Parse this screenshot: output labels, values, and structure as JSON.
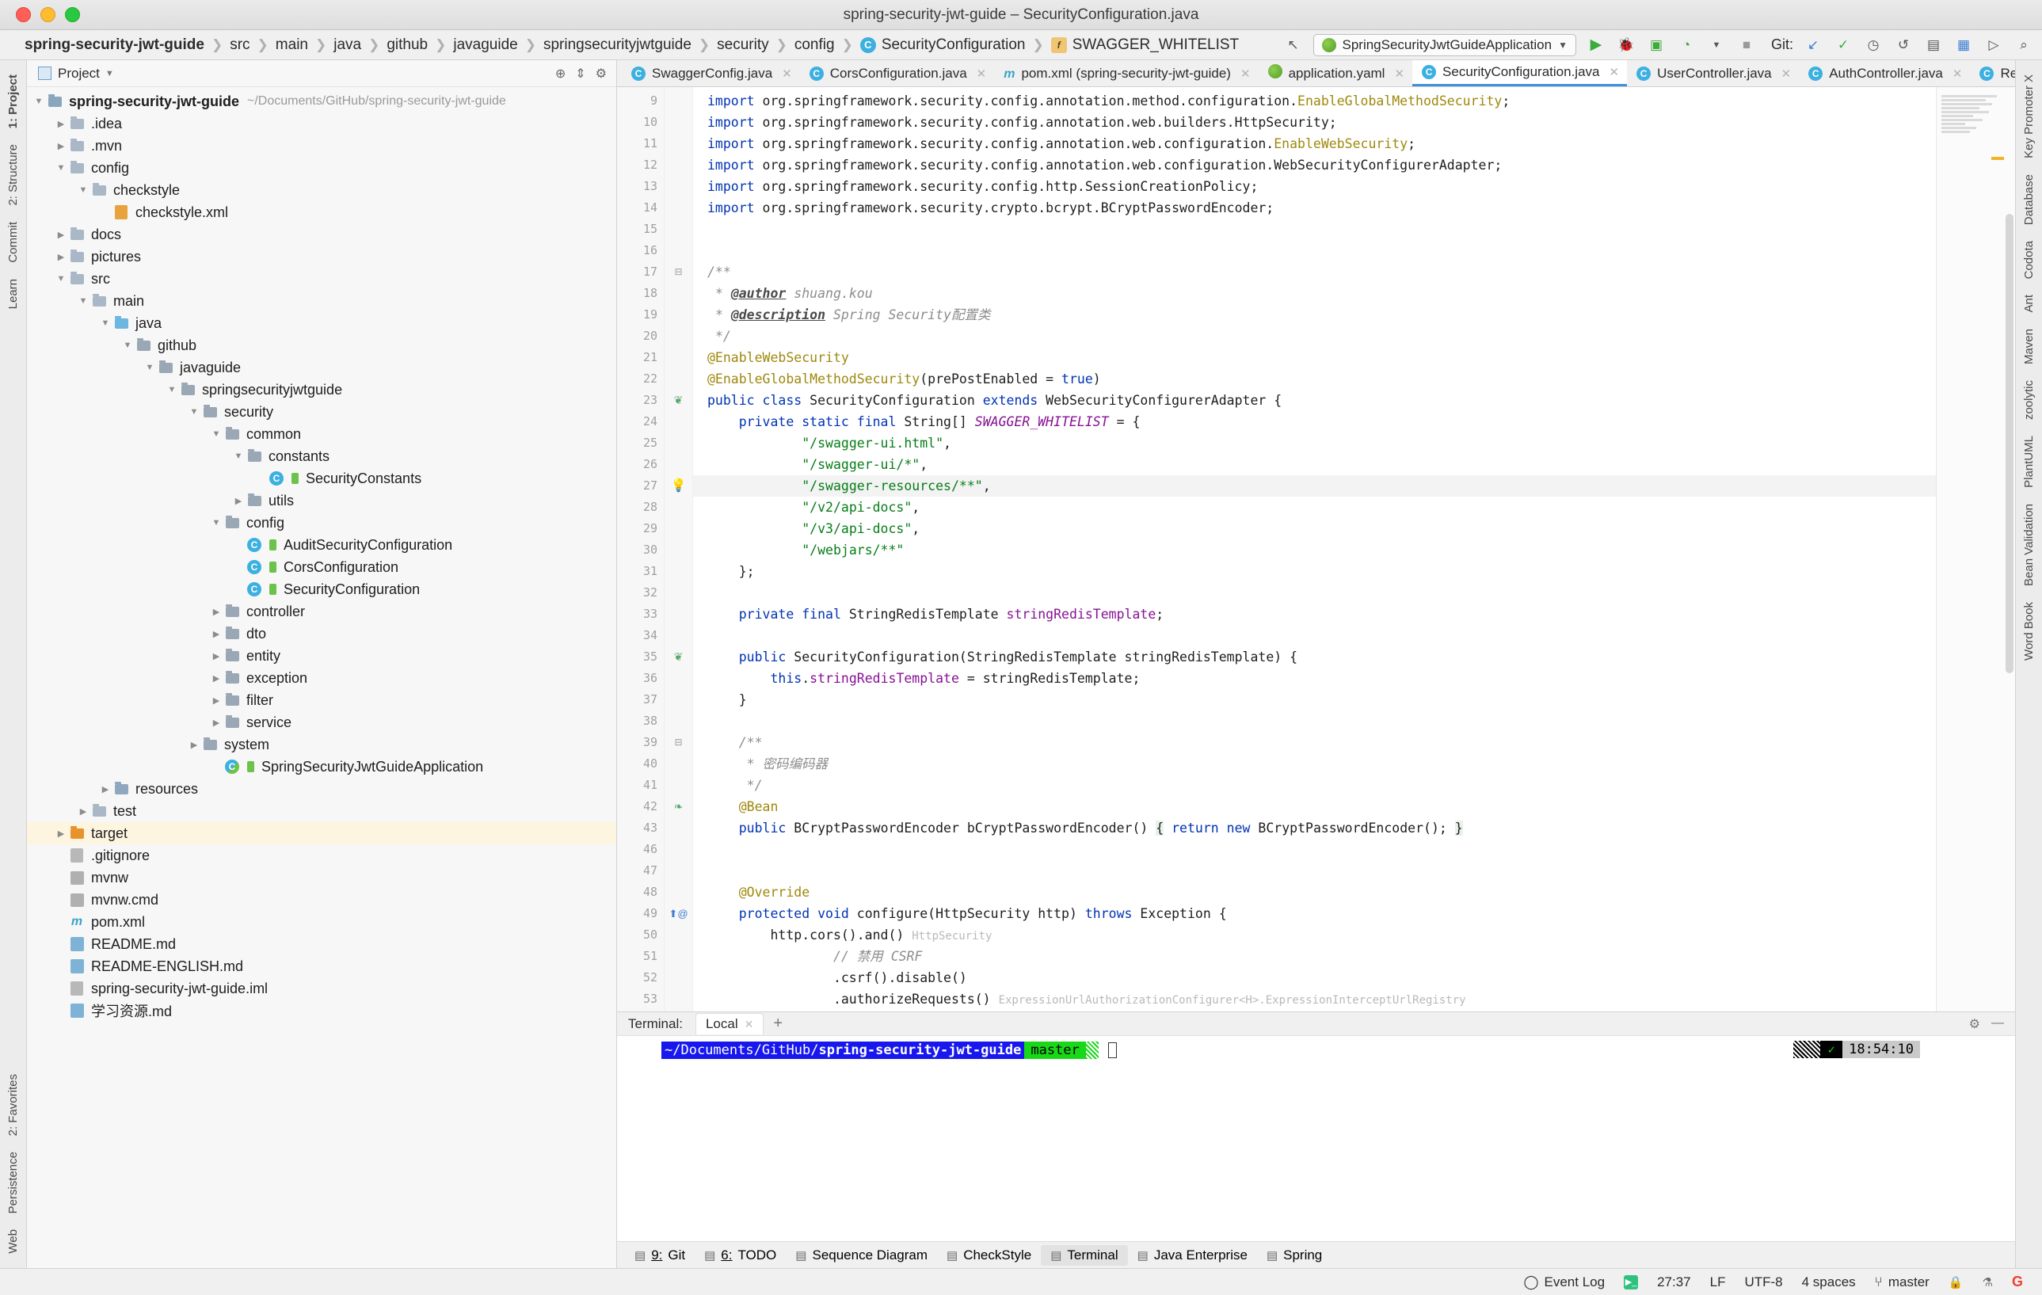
{
  "window": {
    "title": "spring-security-jwt-guide – SecurityConfiguration.java",
    "traffic_lights": [
      "close-red",
      "minimize-yellow",
      "maximize-green"
    ]
  },
  "navbar": {
    "crumbs": [
      {
        "label": "spring-security-jwt-guide",
        "icon": null,
        "root": true
      },
      {
        "label": "src",
        "icon": null
      },
      {
        "label": "main",
        "icon": null
      },
      {
        "label": "java",
        "icon": null
      },
      {
        "label": "github",
        "icon": null
      },
      {
        "label": "javaguide",
        "icon": null
      },
      {
        "label": "springsecurityjwtguide",
        "icon": null
      },
      {
        "label": "security",
        "icon": null
      },
      {
        "label": "config",
        "icon": null
      },
      {
        "label": "SecurityConfiguration",
        "icon": "class-icon"
      },
      {
        "label": "SWAGGER_WHITELIST",
        "icon": "field-icon"
      }
    ],
    "run_config": "SpringSecurityJwtGuideApplication",
    "git_label": "Git:",
    "buttons": [
      "back-arrow-icon",
      "run-icon",
      "debug-icon",
      "run-with-coverage-icon",
      "profile-icon",
      "stop-icon",
      "update-project-icon",
      "commit-icon",
      "history-icon",
      "rollback-icon",
      "search-everywhere-icon"
    ]
  },
  "project_panel": {
    "header": "Project",
    "header_icons": [
      "locate-icon",
      "collapse-all-icon",
      "settings-gear-icon"
    ],
    "tree": [
      {
        "label": "spring-security-jwt-guide",
        "path": "~/Documents/GitHub/spring-security-jwt-guide",
        "indent": 0,
        "arrow": "down",
        "icon": "module-icon",
        "bold": true
      },
      {
        "label": ".idea",
        "indent": 1,
        "arrow": "right",
        "icon": "folder-icon"
      },
      {
        "label": ".mvn",
        "indent": 1,
        "arrow": "right",
        "icon": "folder-icon"
      },
      {
        "label": "config",
        "indent": 1,
        "arrow": "down",
        "icon": "folder-icon"
      },
      {
        "label": "checkstyle",
        "indent": 2,
        "arrow": "down",
        "icon": "folder-icon"
      },
      {
        "label": "checkstyle.xml",
        "indent": 3,
        "arrow": "none",
        "icon": "xml-file-icon"
      },
      {
        "label": "docs",
        "indent": 1,
        "arrow": "right",
        "icon": "folder-icon"
      },
      {
        "label": "pictures",
        "indent": 1,
        "arrow": "right",
        "icon": "folder-icon"
      },
      {
        "label": "src",
        "indent": 1,
        "arrow": "down",
        "icon": "folder-icon"
      },
      {
        "label": "main",
        "indent": 2,
        "arrow": "down",
        "icon": "folder-icon"
      },
      {
        "label": "java",
        "indent": 3,
        "arrow": "down",
        "icon": "source-folder-icon"
      },
      {
        "label": "github",
        "indent": 4,
        "arrow": "down",
        "icon": "package-icon"
      },
      {
        "label": "javaguide",
        "indent": 5,
        "arrow": "down",
        "icon": "package-icon"
      },
      {
        "label": "springsecurityjwtguide",
        "indent": 6,
        "arrow": "down",
        "icon": "package-icon"
      },
      {
        "label": "security",
        "indent": 7,
        "arrow": "down",
        "icon": "package-icon"
      },
      {
        "label": "common",
        "indent": 8,
        "arrow": "down",
        "icon": "package-icon"
      },
      {
        "label": "constants",
        "indent": 9,
        "arrow": "down",
        "icon": "package-icon"
      },
      {
        "label": "SecurityConstants",
        "indent": 10,
        "arrow": "none",
        "icon": "class-icon"
      },
      {
        "label": "utils",
        "indent": 9,
        "arrow": "right",
        "icon": "package-icon"
      },
      {
        "label": "config",
        "indent": 8,
        "arrow": "down",
        "icon": "package-icon"
      },
      {
        "label": "AuditSecurityConfiguration",
        "indent": 9,
        "arrow": "none",
        "icon": "class-icon"
      },
      {
        "label": "CorsConfiguration",
        "indent": 9,
        "arrow": "none",
        "icon": "class-icon"
      },
      {
        "label": "SecurityConfiguration",
        "indent": 9,
        "arrow": "none",
        "icon": "class-icon"
      },
      {
        "label": "controller",
        "indent": 8,
        "arrow": "right",
        "icon": "package-icon"
      },
      {
        "label": "dto",
        "indent": 8,
        "arrow": "right",
        "icon": "package-icon"
      },
      {
        "label": "entity",
        "indent": 8,
        "arrow": "right",
        "icon": "package-icon"
      },
      {
        "label": "exception",
        "indent": 8,
        "arrow": "right",
        "icon": "package-icon"
      },
      {
        "label": "filter",
        "indent": 8,
        "arrow": "right",
        "icon": "package-icon"
      },
      {
        "label": "service",
        "indent": 8,
        "arrow": "right",
        "icon": "package-icon"
      },
      {
        "label": "system",
        "indent": 7,
        "arrow": "right",
        "icon": "package-icon"
      },
      {
        "label": "SpringSecurityJwtGuideApplication",
        "indent": 8,
        "arrow": "none",
        "icon": "spring-class-icon"
      },
      {
        "label": "resources",
        "indent": 3,
        "arrow": "right",
        "icon": "resource-folder-icon"
      },
      {
        "label": "test",
        "indent": 2,
        "arrow": "right",
        "icon": "folder-icon"
      },
      {
        "label": "target",
        "indent": 1,
        "arrow": "right",
        "icon": "excluded-folder-icon",
        "highlight": true
      },
      {
        "label": ".gitignore",
        "indent": 1,
        "arrow": "none",
        "icon": "gitignore-file-icon"
      },
      {
        "label": "mvnw",
        "indent": 1,
        "arrow": "none",
        "icon": "script-file-icon"
      },
      {
        "label": "mvnw.cmd",
        "indent": 1,
        "arrow": "none",
        "icon": "cmd-file-icon"
      },
      {
        "label": "pom.xml",
        "indent": 1,
        "arrow": "none",
        "icon": "maven-file-icon"
      },
      {
        "label": "README.md",
        "indent": 1,
        "arrow": "none",
        "icon": "markdown-file-icon"
      },
      {
        "label": "README-ENGLISH.md",
        "indent": 1,
        "arrow": "none",
        "icon": "markdown-file-icon"
      },
      {
        "label": "spring-security-jwt-guide.iml",
        "indent": 1,
        "arrow": "none",
        "icon": "iml-file-icon"
      },
      {
        "label": "学习资源.md",
        "indent": 1,
        "arrow": "none",
        "icon": "markdown-file-icon"
      }
    ]
  },
  "left_strip": {
    "top": [
      "1: Project",
      "2: Structure",
      "Commit",
      "Learn"
    ],
    "bottom": [
      "2: Favorites",
      "Persistence",
      "Web"
    ]
  },
  "right_strip": {
    "items": [
      "Key Promoter X",
      "Database",
      "Codota",
      "Ant",
      "Maven",
      "zoolytic",
      "PlantUML",
      "Bean Validation",
      "Word Book"
    ]
  },
  "editor_tabs": [
    {
      "label": "SwaggerConfig.java",
      "icon": "class-icon",
      "active": false
    },
    {
      "label": "CorsConfiguration.java",
      "icon": "class-icon",
      "active": false
    },
    {
      "label": "pom.xml (spring-security-jwt-guide)",
      "icon": "maven-file-icon",
      "active": false
    },
    {
      "label": "application.yaml",
      "icon": "spring-yaml-icon",
      "active": false
    },
    {
      "label": "SecurityConfiguration.java",
      "icon": "class-icon",
      "active": true
    },
    {
      "label": "UserController.java",
      "icon": "class-icon",
      "active": false
    },
    {
      "label": "AuthController.java",
      "icon": "class-icon",
      "active": false
    },
    {
      "label": "RedisConfig.java",
      "icon": "class-icon",
      "active": false
    }
  ],
  "code": {
    "first_line": 9,
    "current_line": 27,
    "lines": [
      {
        "n": 9,
        "html": "<span class=\"kw\">import</span> org.springframework.security.config.annotation.method.configuration.<span class=\"ann\">EnableGlobalMethodSecurity</span>;"
      },
      {
        "n": 10,
        "html": "<span class=\"kw\">import</span> org.springframework.security.config.annotation.web.builders.HttpSecurity;"
      },
      {
        "n": 11,
        "html": "<span class=\"kw\">import</span> org.springframework.security.config.annotation.web.configuration.<span class=\"ann\">EnableWebSecurity</span>;"
      },
      {
        "n": 12,
        "html": "<span class=\"kw\">import</span> org.springframework.security.config.annotation.web.configuration.WebSecurityConfigurerAdapter;"
      },
      {
        "n": 13,
        "html": "<span class=\"kw\">import</span> org.springframework.security.config.http.SessionCreationPolicy;"
      },
      {
        "n": 14,
        "html": "<span class=\"kw\">import</span> org.springframework.security.crypto.bcrypt.BCryptPasswordEncoder;"
      },
      {
        "n": 15,
        "html": ""
      },
      {
        "n": 16,
        "html": ""
      },
      {
        "n": 17,
        "html": "<span class=\"doc\">/**</span>",
        "fold": true
      },
      {
        "n": 18,
        "html": " <span class=\"doc\">* </span><span class=\"doctag\">@author</span><span class=\"doc\"> shuang.kou</span>"
      },
      {
        "n": 19,
        "html": " <span class=\"doc\">* </span><span class=\"doctag\">@description</span><span class=\"doc\"> Spring Security配置类</span>"
      },
      {
        "n": 20,
        "html": " <span class=\"doc\">*/</span>"
      },
      {
        "n": 21,
        "html": "<span class=\"ann\">@EnableWebSecurity</span>"
      },
      {
        "n": 22,
        "html": "<span class=\"ann\">@EnableGlobalMethodSecurity</span>(prePostEnabled = <span class=\"kw\">true</span>)"
      },
      {
        "n": 23,
        "html": "<span class=\"kw\">public class</span> SecurityConfiguration <span class=\"kw\">extends</span> WebSecurityConfigurerAdapter {",
        "gmark": "spring"
      },
      {
        "n": 24,
        "html": "    <span class=\"kw\">private static final</span> String[] <span class=\"sfld\">SWAGGER_WHITELIST</span> = {"
      },
      {
        "n": 25,
        "html": "            <span class=\"str\">\"/swagger-ui.html\"</span>,"
      },
      {
        "n": 26,
        "html": "            <span class=\"str\">\"/swagger-ui/*\"</span>,"
      },
      {
        "n": 27,
        "html": "            <span class=\"str\">\"/swagger-resources/**\"</span>,",
        "gmark": "bulb",
        "current": true
      },
      {
        "n": 28,
        "html": "            <span class=\"str\">\"/v2/api-docs\"</span>,"
      },
      {
        "n": 29,
        "html": "            <span class=\"str\">\"/v3/api-docs\"</span>,"
      },
      {
        "n": 30,
        "html": "            <span class=\"str\">\"/webjars/**\"</span>"
      },
      {
        "n": 31,
        "html": "    };"
      },
      {
        "n": 32,
        "html": ""
      },
      {
        "n": 33,
        "html": "    <span class=\"kw\">private final</span> StringRedisTemplate <span class=\"fld\">stringRedisTemplate</span>;"
      },
      {
        "n": 34,
        "html": ""
      },
      {
        "n": 35,
        "html": "    <span class=\"kw\">public</span> SecurityConfiguration(StringRedisTemplate stringRedisTemplate) {",
        "gmark": "spring"
      },
      {
        "n": 36,
        "html": "        <span class=\"kw\">this</span>.<span class=\"fld\">stringRedisTemplate</span> = stringRedisTemplate;"
      },
      {
        "n": 37,
        "html": "    }"
      },
      {
        "n": 38,
        "html": ""
      },
      {
        "n": 39,
        "html": "    <span class=\"doc\">/**</span>",
        "fold": true
      },
      {
        "n": 40,
        "html": "     <span class=\"doc\">* 密码编码器</span>"
      },
      {
        "n": 41,
        "html": "     <span class=\"doc\">*/</span>"
      },
      {
        "n": 42,
        "html": "    <span class=\"ann\">@Bean</span>",
        "gmark": "bean"
      },
      {
        "n": 43,
        "html": "    <span class=\"kw\">public</span> BCryptPasswordEncoder bCryptPasswordEncoder() <span class=\"hl\">{</span> <span class=\"kw\">return new</span> BCryptPasswordEncoder(); <span class=\"hl\">}</span>"
      },
      {
        "n": 46,
        "html": ""
      },
      {
        "n": 47,
        "html": ""
      },
      {
        "n": 48,
        "html": "    <span class=\"ann\">@Override</span>"
      },
      {
        "n": 49,
        "html": "    <span class=\"kw\">protected void</span> configure(HttpSecurity http) <span class=\"kw\">throws</span> Exception {",
        "gmark": "override"
      },
      {
        "n": 50,
        "html": "        http.cors().and() <span class=\"hint\">HttpSecurity</span>"
      },
      {
        "n": 51,
        "html": "                <span class=\"cmt\">// 禁用 CSRF</span>"
      },
      {
        "n": 52,
        "html": "                .csrf().disable()"
      },
      {
        "n": 53,
        "html": "                .authorizeRequests() <span class=\"hint\">ExpressionUrlAuthorizationConfigurer&lt;H&gt;.ExpressionInterceptUrlRegistry</span>"
      }
    ]
  },
  "terminal": {
    "label": "Terminal:",
    "tab": "Local",
    "prompt_path_prefix": "~/Documents/GitHub/",
    "prompt_path_project": "spring-security-jwt-guide",
    "branch": "master",
    "clock": "18:54:10"
  },
  "bottom_tools": [
    {
      "key": "9",
      "label": "Git",
      "icon": "git-branch-icon",
      "active": false
    },
    {
      "key": "6",
      "label": "TODO",
      "icon": "todo-list-icon",
      "active": false
    },
    {
      "key": "",
      "label": "Sequence Diagram",
      "icon": "sequence-diagram-icon",
      "active": false
    },
    {
      "key": "",
      "label": "CheckStyle",
      "icon": "checkstyle-icon",
      "active": false
    },
    {
      "key": "",
      "label": "Terminal",
      "icon": "terminal-icon",
      "active": true
    },
    {
      "key": "",
      "label": "Java Enterprise",
      "icon": "java-enterprise-icon",
      "active": false
    },
    {
      "key": "",
      "label": "Spring",
      "icon": "spring-icon",
      "active": false
    }
  ],
  "status_bar": {
    "event_log": "Event Log",
    "caret_position": "27:37",
    "line_separator": "LF",
    "encoding": "UTF-8",
    "indent": "4 spaces",
    "branch": "master",
    "icons": [
      "terminal-status-icon",
      "lock-icon",
      "inspection-icon",
      "google-icon"
    ]
  }
}
